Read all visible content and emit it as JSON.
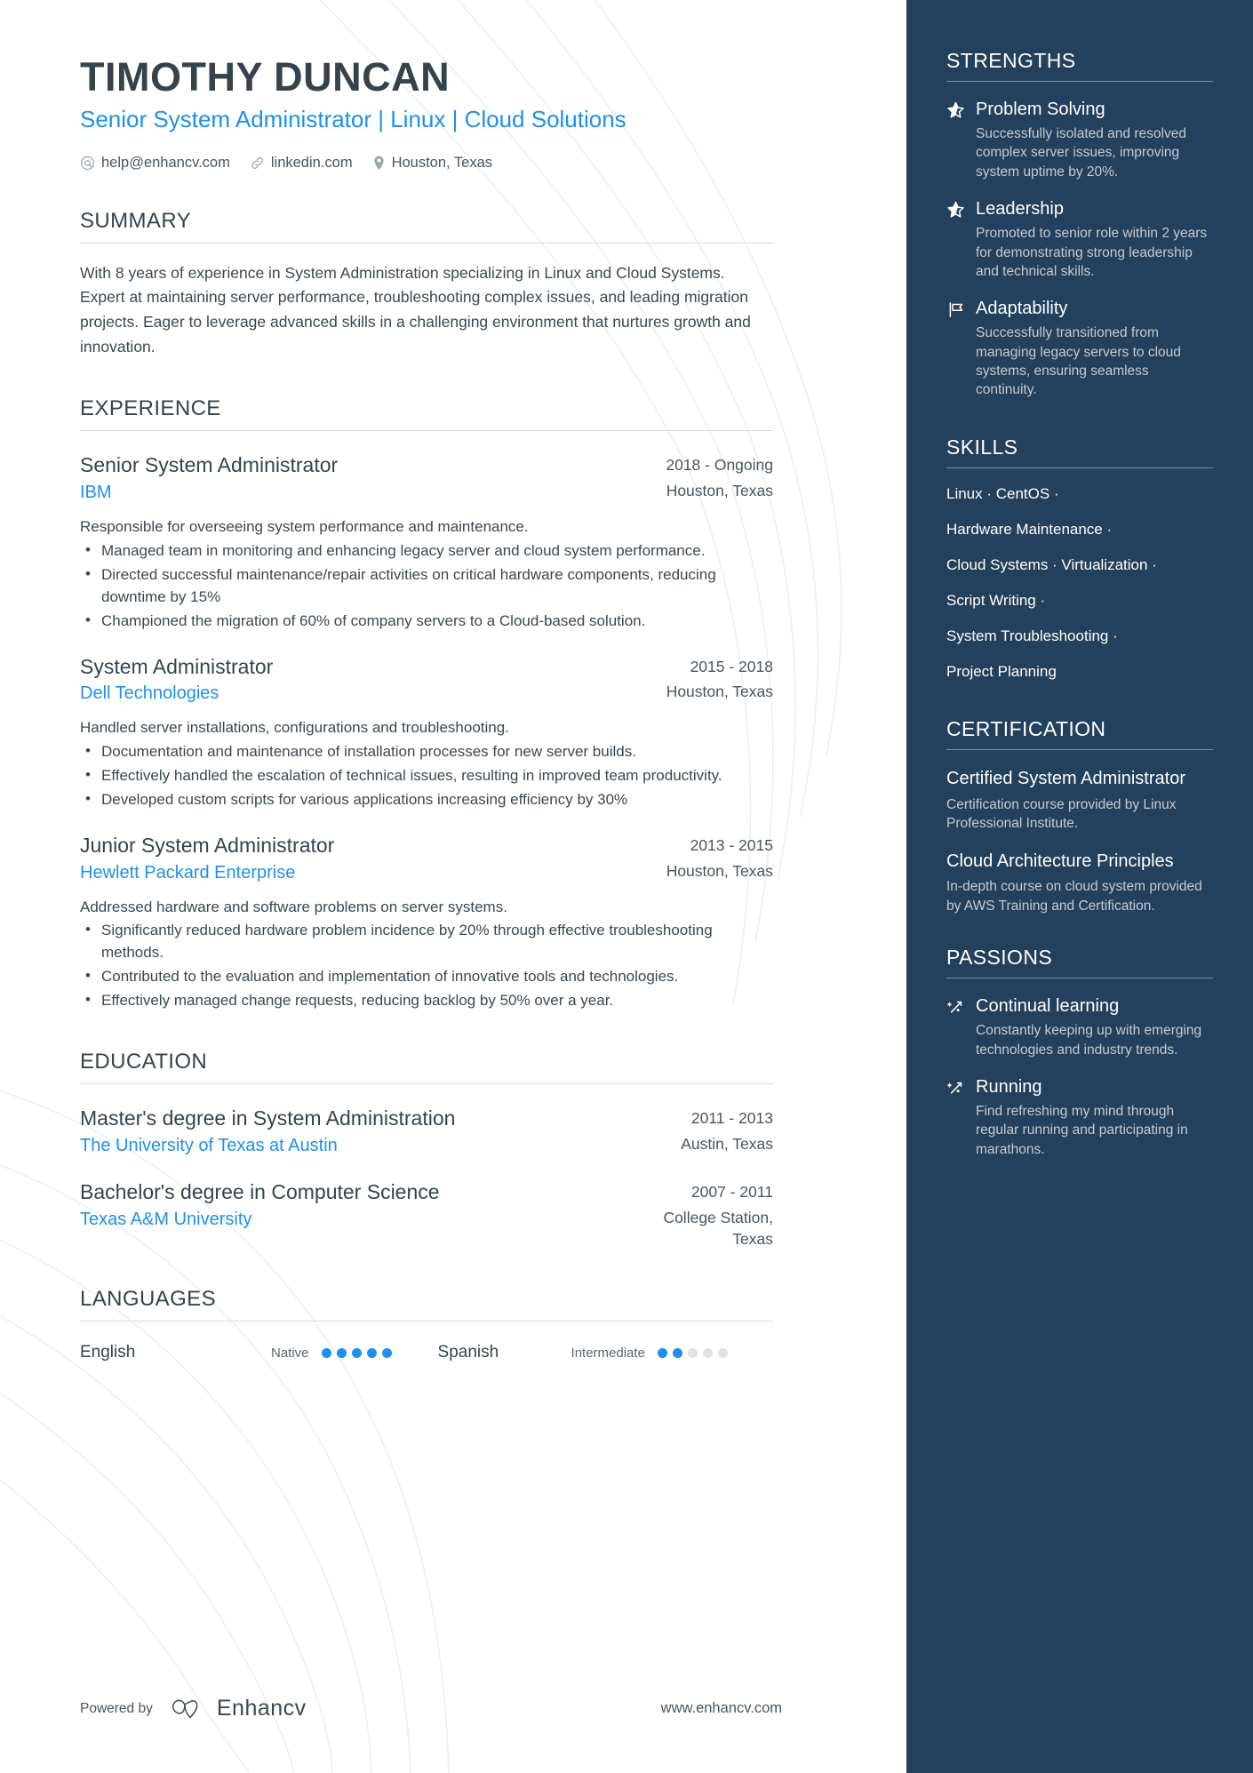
{
  "colors": {
    "sidebar_bg": "#23405c",
    "accent_blue": "#1a91f0",
    "heading_dark": "#36434c",
    "body_text": "#3c4850",
    "muted_text": "#c4ccd4"
  },
  "header": {
    "name": "TIMOTHY DUNCAN",
    "headline": "Senior System Administrator | Linux | Cloud Solutions",
    "contacts": [
      {
        "icon": "at-icon",
        "text": "help@enhancv.com"
      },
      {
        "icon": "link-icon",
        "text": "linkedin.com"
      },
      {
        "icon": "location-pin-icon",
        "text": "Houston, Texas"
      }
    ]
  },
  "summary": {
    "title": "SUMMARY",
    "text": "With 8 years of experience in System Administration specializing in Linux and Cloud Systems. Expert at maintaining server performance, troubleshooting complex issues, and leading migration projects. Eager to leverage advanced skills in a challenging environment that nurtures growth and innovation."
  },
  "experience": {
    "title": "EXPERIENCE",
    "entries": [
      {
        "role": "Senior System Administrator",
        "dates": "2018 - Ongoing",
        "org": "IBM",
        "location": "Houston, Texas",
        "description": "Responsible for overseeing system performance and maintenance.",
        "bullets": [
          "Managed team in monitoring and enhancing legacy server and cloud system performance.",
          "Directed successful maintenance/repair activities on critical hardware components, reducing downtime by 15%",
          "Championed the migration of 60% of company servers to a Cloud-based solution."
        ]
      },
      {
        "role": "System Administrator",
        "dates": "2015 - 2018",
        "org": "Dell Technologies",
        "location": "Houston, Texas",
        "description": "Handled server installations, configurations and troubleshooting.",
        "bullets": [
          "Documentation and maintenance of installation processes for new server builds.",
          "Effectively handled the escalation of technical issues, resulting in improved team productivity.",
          "Developed custom scripts for various applications increasing efficiency by 30%"
        ]
      },
      {
        "role": "Junior System Administrator",
        "dates": "2013 - 2015",
        "org": "Hewlett Packard Enterprise",
        "location": "Houston, Texas",
        "description": "Addressed hardware and software problems on server systems.",
        "bullets": [
          "Significantly reduced hardware problem incidence by 20% through effective troubleshooting methods.",
          "Contributed to the evaluation and implementation of innovative tools and technologies.",
          "Effectively managed change requests, reducing backlog by 50% over a year."
        ]
      }
    ]
  },
  "education": {
    "title": "EDUCATION",
    "entries": [
      {
        "degree": "Master's degree in System Administration",
        "dates": "2011 - 2013",
        "school": "The University of Texas at Austin",
        "location": "Austin, Texas"
      },
      {
        "degree": "Bachelor's degree in Computer Science",
        "dates": "2007 - 2011",
        "school": "Texas A&M University",
        "location": "College Station, Texas"
      }
    ]
  },
  "languages": {
    "title": "LANGUAGES",
    "items": [
      {
        "name": "English",
        "level": "Native",
        "filled": 5,
        "total": 5
      },
      {
        "name": "Spanish",
        "level": "Intermediate",
        "filled": 2,
        "total": 5
      }
    ]
  },
  "footer": {
    "powered_by": "Powered by",
    "brand": "Enhancv",
    "brand_icon": "enhancv-logo-icon",
    "website": "www.enhancv.com"
  },
  "strengths": {
    "title": "STRENGTHS",
    "items": [
      {
        "icon": "star-icon",
        "title": "Problem Solving",
        "description": "Successfully isolated and resolved complex server issues, improving system uptime by 20%."
      },
      {
        "icon": "star-icon",
        "title": "Leadership",
        "description": "Promoted to senior role within 2 years for demonstrating strong leadership and technical skills."
      },
      {
        "icon": "flag-icon",
        "title": "Adaptability",
        "description": "Successfully transitioned from managing legacy servers to cloud systems, ensuring seamless continuity."
      }
    ]
  },
  "skills": {
    "title": "SKILLS",
    "lines": [
      "Linux · CentOS ·",
      "Hardware Maintenance ·",
      "Cloud Systems · Virtualization ·",
      "Script Writing ·",
      "System Troubleshooting ·",
      "Project Planning"
    ]
  },
  "certification": {
    "title": "CERTIFICATION",
    "items": [
      {
        "title": "Certified System Administrator",
        "description": "Certification course provided by Linux Professional Institute."
      },
      {
        "title": "Cloud Architecture Principles",
        "description": "In-depth course on cloud system provided by AWS Training and Certification."
      }
    ]
  },
  "passions": {
    "title": "PASSIONS",
    "items": [
      {
        "icon": "sparkle-icon",
        "title": "Continual learning",
        "description": "Constantly keeping up with emerging technologies and industry trends."
      },
      {
        "icon": "sparkle-icon",
        "title": "Running",
        "description": "Find refreshing my mind through regular running and participating in marathons."
      }
    ]
  }
}
